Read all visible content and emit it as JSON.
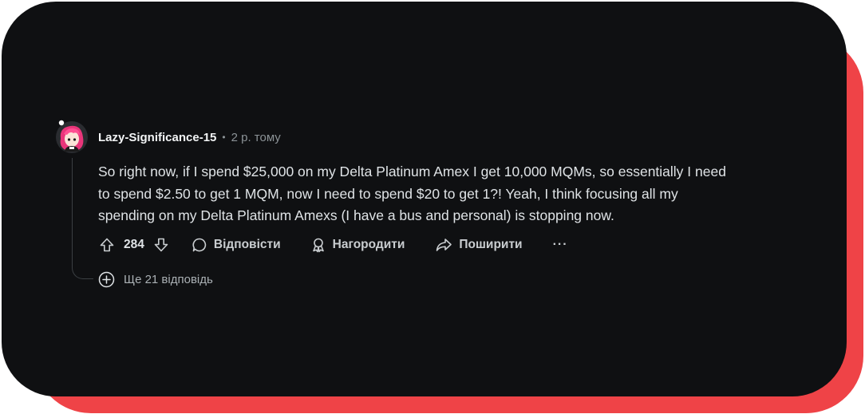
{
  "colors": {
    "accent_background": "#ef4347",
    "card_background": "#0f1012",
    "text_primary": "#f2f4f5",
    "text_muted": "#8b9296"
  },
  "comment": {
    "author": "Lazy-Significance-15",
    "separator": "•",
    "timestamp": "2 р. тому",
    "avatar_icon": "anime-girl-avatar",
    "body_lines": [
      "So right now, if I spend $25,000 on my Delta Platinum Amex I get 10,000 MQMs, so essentially I need",
      "to spend $2.50 to get 1 MQM, now I need to spend $20 to get 1?! Yeah, I think focusing all my",
      "spending on my Delta Platinum Amexs (I have a bus and personal) is stopping now."
    ]
  },
  "actions": {
    "upvote_icon": "arrow-up-icon",
    "score": "284",
    "downvote_icon": "arrow-down-icon",
    "reply_label": "Відповісти",
    "award_label": "Нагородити",
    "share_label": "Поширити",
    "more_label": "···"
  },
  "more_replies": {
    "icon": "plus-circle-icon",
    "label": "Ще 21 відповідь"
  }
}
